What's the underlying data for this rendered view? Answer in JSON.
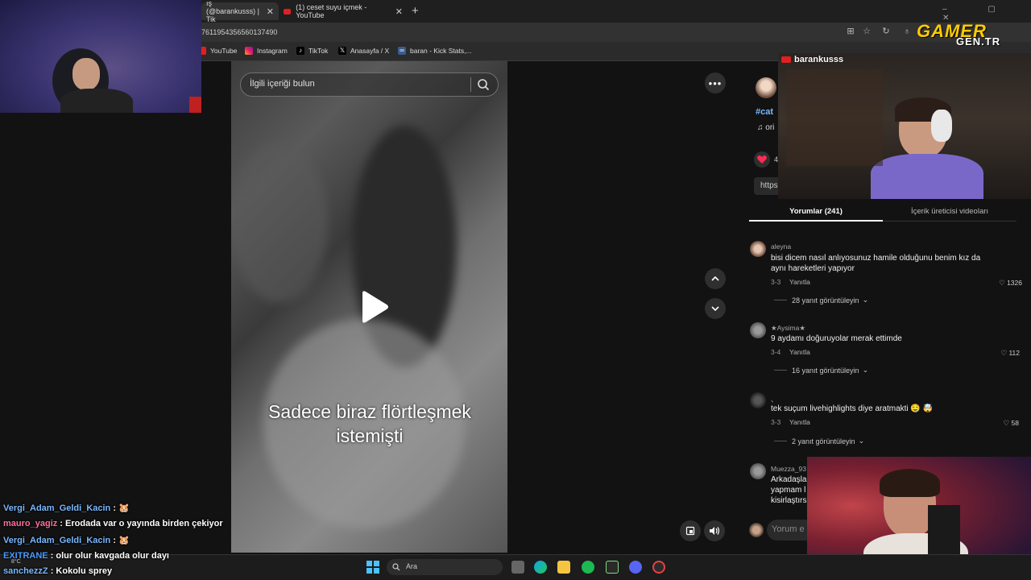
{
  "browser": {
    "tabs": [
      {
        "label": "ış (@barankusss) | Tik",
        "close": "✕"
      },
      {
        "label": "(1) ceset suyu içmek - YouTube",
        "close": "✕"
      }
    ],
    "new_tab": "+",
    "url": "7611954356560137490",
    "bookmarks": [
      "YouTube",
      "Instagram",
      "TikTok",
      "Anasayfa / X",
      "baran - Kick Stats,..."
    ]
  },
  "tiktok": {
    "search_placeholder": "İlgili içeriği bulun",
    "caption_line1": "Sadece biraz flörtleşmek",
    "caption_line2": "istemişti",
    "hashtag": "#cat",
    "music": "♫ ori",
    "like_count": "4",
    "link_text": "https",
    "tabs": {
      "comments": "Yorumlar (241)",
      "creator": "İçerik üreticisi videoları"
    },
    "comment_placeholder": "Yorum e",
    "comments": [
      {
        "user": "aleyna",
        "text": "bisi dicem nasıl anlıyosunuz hamile olduğunu benim kız da aynı hareketleri yapıyor",
        "date": "3-3",
        "reply": "Yanıtla",
        "likes": "1326",
        "thread": "28 yanıt görüntüleyin"
      },
      {
        "user": "★Aysima★",
        "text": "9 aydamı doğuruyolar merak ettimde",
        "date": "3-4",
        "reply": "Yanıtla",
        "likes": "112",
        "thread": "16 yanıt görüntüleyin"
      },
      {
        "user": "、",
        "text": "tek suçum livehighlights diye aratmakti 🤤 🤯",
        "date": "3-3",
        "reply": "Yanıtla",
        "likes": "58",
        "thread": "2 yanıt görüntüleyin"
      },
      {
        "user": "Muezza_93",
        "text": "Arkadaşla yapmam l kisirlaştırs",
        "date": "",
        "reply": "",
        "likes": "",
        "thread": ""
      }
    ]
  },
  "overlay": {
    "yt_channel": "barankusss",
    "logo_top": "GAMER",
    "logo_bottom": "GEN.TR"
  },
  "chat": [
    {
      "user": "Vergi_Adam_Geldi_Kacin",
      "user_color": "#7ab8ff",
      "msg": " : 🐹"
    },
    {
      "user": "mauro_yagiz",
      "user_color": "#ff6f9a",
      "msg": " : Erodada var o yayında birden çekiyor"
    },
    {
      "user": "Vergi_Adam_Geldi_Kacin",
      "user_color": "#7ab8ff",
      "msg": " : 🐹"
    },
    {
      "user": "EXITRANE",
      "user_color": "#4a9cff",
      "msg": " : olur olur kavgada olur dayı"
    },
    {
      "user": "sanchezzZ",
      "user_color": "#7ab8ff",
      "msg": " : Kokolu sprey"
    }
  ],
  "taskbar": {
    "search": "Ara",
    "weather": "8°C"
  },
  "colors": {
    "accent_heart": "#fe2c55",
    "youtube_red": "#e02020",
    "logo_yellow": "#ffcc00"
  }
}
